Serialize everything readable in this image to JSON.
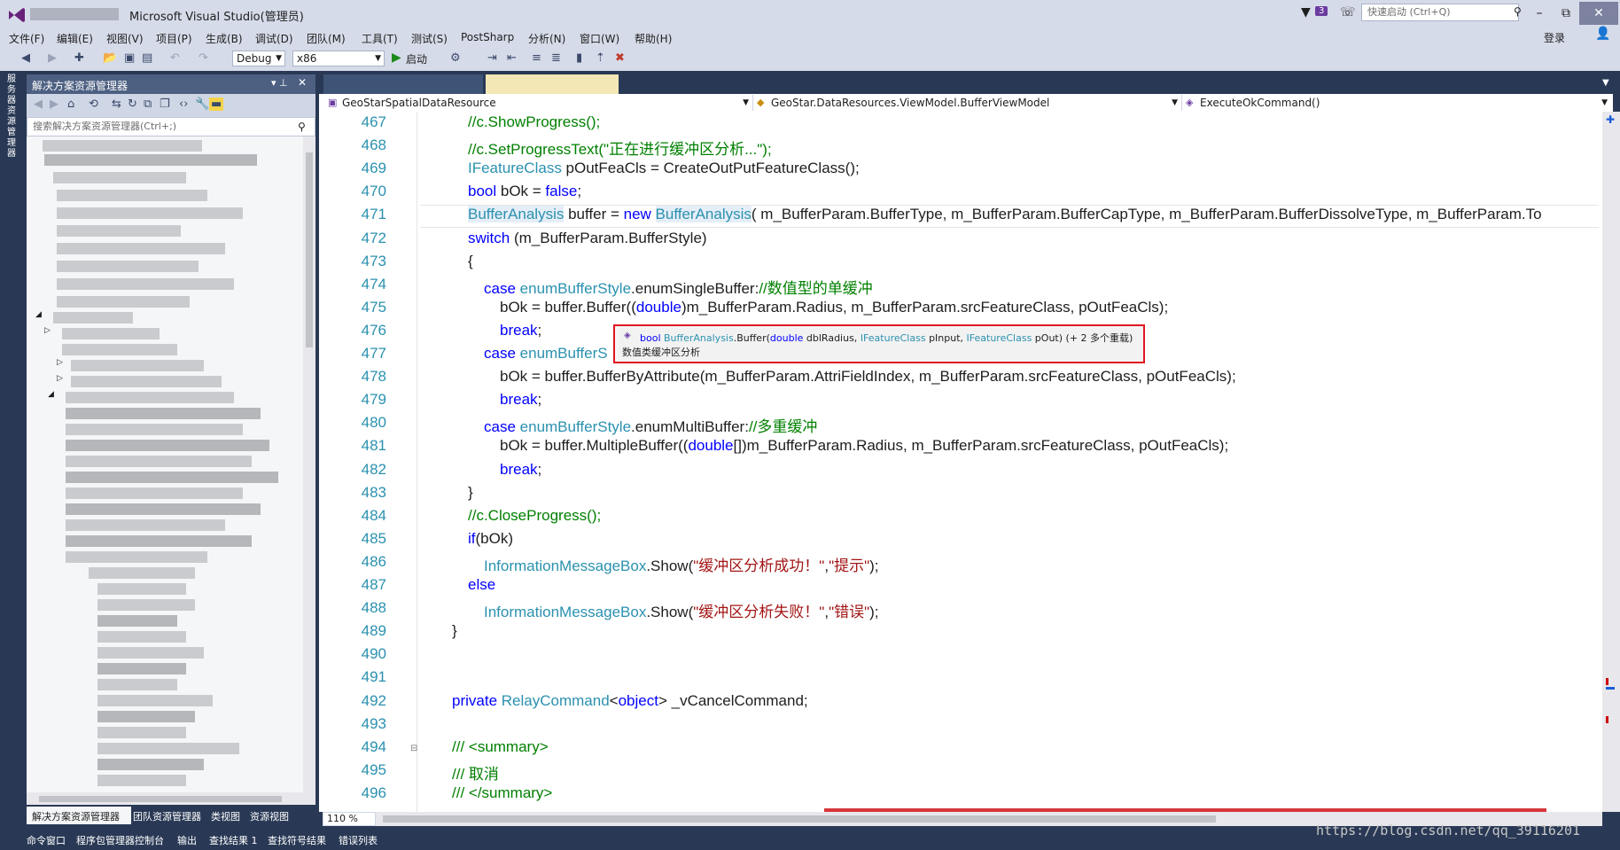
{
  "window": {
    "title": "Microsoft Visual Studio(管理员)",
    "notify_count": "3",
    "quick_launch_placeholder": "快速启动 (Ctrl+Q)",
    "login": "登录",
    "min": "–",
    "restore": "⧉",
    "close": "✕"
  },
  "menu": [
    "文件(F)",
    "编辑(E)",
    "视图(V)",
    "项目(P)",
    "生成(B)",
    "调试(D)",
    "团队(M)",
    "工具(T)",
    "测试(S)",
    "PostSharp",
    "分析(N)",
    "窗口(W)",
    "帮助(H)"
  ],
  "toolbar": {
    "config": "Debug",
    "platform": "x86",
    "run_label": "启动"
  },
  "left_tab": "服务器资源管理器",
  "solution_explorer": {
    "title": "解决方案资源管理器",
    "search_placeholder": "搜索解决方案资源管理器(Ctrl+;)",
    "bottom_tabs": [
      "解决方案资源管理器",
      "团队资源管理器",
      "类视图",
      "资源视图"
    ]
  },
  "navbar": {
    "project": "GeoStarSpatialDataResource",
    "class": "GeoStar.DataResources.ViewModel.BufferViewModel",
    "member": "ExecuteOkCommand()"
  },
  "code_lines": [
    {
      "n": "467",
      "parts": [
        {
          "t": "//c.ShowProgress();",
          "c": "cm"
        }
      ],
      "indent": 2
    },
    {
      "n": "468",
      "parts": [
        {
          "t": "//c.SetProgressText(\"正在进行缓冲区分析...\");",
          "c": "cm"
        }
      ],
      "indent": 2
    },
    {
      "n": "469",
      "parts": [
        {
          "t": "IFeatureClass",
          "c": "ty"
        },
        {
          "t": " pOutFeaCls = CreateOutPutFeatureClass();",
          "c": ""
        }
      ],
      "indent": 2
    },
    {
      "n": "470",
      "parts": [
        {
          "t": "bool",
          "c": "kw"
        },
        {
          "t": " bOk = ",
          "c": ""
        },
        {
          "t": "false",
          "c": "kw"
        },
        {
          "t": ";",
          "c": ""
        }
      ],
      "indent": 2
    },
    {
      "n": "471",
      "parts": [
        {
          "t": "BufferAnalysis",
          "c": "ty hl"
        },
        {
          "t": " buffer = ",
          "c": ""
        },
        {
          "t": "new",
          "c": "kw"
        },
        {
          "t": " ",
          "c": ""
        },
        {
          "t": "BufferAnalysis",
          "c": "ty hl"
        },
        {
          "t": "( m_BufferParam.BufferType, m_BufferParam.BufferCapType, m_BufferParam.BufferDissolveType, m_BufferParam.To",
          "c": ""
        }
      ],
      "indent": 2
    },
    {
      "n": "472",
      "parts": [
        {
          "t": "switch",
          "c": "kw"
        },
        {
          "t": " (m_BufferParam.BufferStyle)",
          "c": ""
        }
      ],
      "indent": 2
    },
    {
      "n": "473",
      "parts": [
        {
          "t": "{",
          "c": ""
        }
      ],
      "indent": 2
    },
    {
      "n": "474",
      "parts": [
        {
          "t": "case",
          "c": "kw"
        },
        {
          "t": " ",
          "c": ""
        },
        {
          "t": "enumBufferStyle",
          "c": "ty"
        },
        {
          "t": ".enumSingleBuffer:",
          "c": ""
        },
        {
          "t": "//数值型的单缓冲",
          "c": "cm"
        }
      ],
      "indent": 3
    },
    {
      "n": "475",
      "parts": [
        {
          "t": "bOk = buffer.Buffer((",
          "c": ""
        },
        {
          "t": "double",
          "c": "kw"
        },
        {
          "t": ")m_BufferParam.Radius, m_BufferParam.srcFeatureClass, pOutFeaCls);",
          "c": ""
        }
      ],
      "indent": 4
    },
    {
      "n": "476",
      "parts": [
        {
          "t": "break",
          "c": "kw"
        },
        {
          "t": ";",
          "c": ""
        }
      ],
      "indent": 4
    },
    {
      "n": "477",
      "parts": [
        {
          "t": "case",
          "c": "kw"
        },
        {
          "t": " ",
          "c": ""
        },
        {
          "t": "enumBufferS",
          "c": "ty"
        }
      ],
      "indent": 3
    },
    {
      "n": "478",
      "parts": [
        {
          "t": "bOk = buffer.BufferByAttribute(m_BufferParam.AttriFieldIndex, m_BufferParam.srcFeatureClass, pOutFeaCls);",
          "c": ""
        }
      ],
      "indent": 4
    },
    {
      "n": "479",
      "parts": [
        {
          "t": "break",
          "c": "kw"
        },
        {
          "t": ";",
          "c": ""
        }
      ],
      "indent": 4
    },
    {
      "n": "480",
      "parts": [
        {
          "t": "case",
          "c": "kw"
        },
        {
          "t": " ",
          "c": ""
        },
        {
          "t": "enumBufferStyle",
          "c": "ty"
        },
        {
          "t": ".enumMultiBuffer:",
          "c": ""
        },
        {
          "t": "//多重缓冲",
          "c": "cm"
        }
      ],
      "indent": 3
    },
    {
      "n": "481",
      "parts": [
        {
          "t": "bOk = buffer.MultipleBuffer((",
          "c": ""
        },
        {
          "t": "double",
          "c": "kw"
        },
        {
          "t": "[])m_BufferParam.Radius, m_BufferParam.srcFeatureClass, pOutFeaCls);",
          "c": ""
        }
      ],
      "indent": 4
    },
    {
      "n": "482",
      "parts": [
        {
          "t": "break",
          "c": "kw"
        },
        {
          "t": ";",
          "c": ""
        }
      ],
      "indent": 4
    },
    {
      "n": "483",
      "parts": [
        {
          "t": "}",
          "c": ""
        }
      ],
      "indent": 2
    },
    {
      "n": "484",
      "parts": [
        {
          "t": "//c.CloseProgress();",
          "c": "cm"
        }
      ],
      "indent": 2
    },
    {
      "n": "485",
      "parts": [
        {
          "t": "if",
          "c": "kw"
        },
        {
          "t": "(bOk)",
          "c": ""
        }
      ],
      "indent": 2
    },
    {
      "n": "486",
      "parts": [
        {
          "t": "InformationMessageBox",
          "c": "ty"
        },
        {
          "t": ".Show(",
          "c": ""
        },
        {
          "t": "\"缓冲区分析成功！\"",
          "c": "st"
        },
        {
          "t": ",",
          "c": ""
        },
        {
          "t": "\"提示\"",
          "c": "st"
        },
        {
          "t": ");",
          "c": ""
        }
      ],
      "indent": 3
    },
    {
      "n": "487",
      "parts": [
        {
          "t": "else",
          "c": "kw"
        }
      ],
      "indent": 2
    },
    {
      "n": "488",
      "parts": [
        {
          "t": "InformationMessageBox",
          "c": "ty"
        },
        {
          "t": ".Show(",
          "c": ""
        },
        {
          "t": "\"缓冲区分析失败！\"",
          "c": "st"
        },
        {
          "t": ",",
          "c": ""
        },
        {
          "t": "\"错误\"",
          "c": "st"
        },
        {
          "t": ");",
          "c": ""
        }
      ],
      "indent": 3
    },
    {
      "n": "489",
      "parts": [
        {
          "t": "}",
          "c": ""
        }
      ],
      "indent": 1
    },
    {
      "n": "490",
      "parts": [],
      "indent": 1
    },
    {
      "n": "491",
      "parts": [],
      "indent": 1
    },
    {
      "n": "492",
      "parts": [
        {
          "t": "private",
          "c": "kw"
        },
        {
          "t": " ",
          "c": ""
        },
        {
          "t": "RelayCommand",
          "c": "ty"
        },
        {
          "t": "<",
          "c": ""
        },
        {
          "t": "object",
          "c": "kw"
        },
        {
          "t": "> _vCancelCommand;",
          "c": ""
        }
      ],
      "indent": 1
    },
    {
      "n": "493",
      "parts": [],
      "indent": 1
    },
    {
      "n": "494",
      "parts": [
        {
          "t": "/// <summary>",
          "c": "cm"
        }
      ],
      "indent": 1
    },
    {
      "n": "495",
      "parts": [
        {
          "t": "/// 取消",
          "c": "cm"
        }
      ],
      "indent": 1
    },
    {
      "n": "496",
      "parts": [
        {
          "t": "/// </summary>",
          "c": "cm"
        }
      ],
      "indent": 1
    }
  ],
  "tooltip": {
    "signature": [
      {
        "t": "bool",
        "c": "kw"
      },
      {
        "t": " ",
        "c": ""
      },
      {
        "t": "BufferAnalysis",
        "c": "ty"
      },
      {
        "t": ".Buffer(",
        "c": ""
      },
      {
        "t": "double",
        "c": "kw"
      },
      {
        "t": " dblRadius, ",
        "c": ""
      },
      {
        "t": "IFeatureClass",
        "c": "ty"
      },
      {
        "t": " pInput, ",
        "c": ""
      },
      {
        "t": "IFeatureClass",
        "c": "ty"
      },
      {
        "t": " pOut) (+ 2 多个重载)",
        "c": ""
      }
    ],
    "description": "数值类缓冲区分析"
  },
  "zoom": "110 %",
  "bottom_tabs": [
    "命令窗口",
    "程序包管理器控制台",
    "输出",
    "查找结果 1",
    "查找符号结果",
    "错误列表"
  ],
  "watermark": "https://blog.csdn.net/qq_39116201"
}
